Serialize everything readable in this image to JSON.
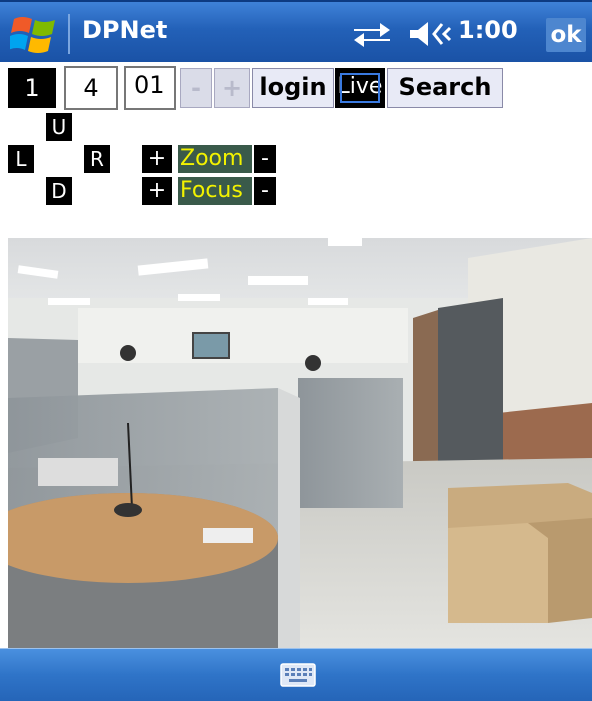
{
  "titlebar": {
    "app_title": "DPNet",
    "clock": "1:00",
    "ok_label": "ok",
    "icons": [
      "windows-start-icon",
      "connectivity-icon",
      "volume-icon"
    ]
  },
  "controls": {
    "camera_number": "1",
    "channel_value": "4",
    "channel_field": "01",
    "minus_label": "-",
    "plus_label": "+",
    "login_label": "login",
    "live_label": "Live",
    "search_label": "Search"
  },
  "ptz": {
    "up": "U",
    "left": "L",
    "right": "R",
    "down": "D",
    "zoom_plus": "+",
    "zoom_label": "Zoom",
    "zoom_minus": "-",
    "focus_plus": "+",
    "focus_label": "Focus",
    "focus_minus": "-"
  },
  "colors": {
    "titlebar_blue": "#2361b8",
    "label_text_yellow": "#f2f200",
    "label_bg": "#3a5a4a"
  },
  "bottombar": {
    "icons": [
      "keyboard-icon"
    ]
  }
}
